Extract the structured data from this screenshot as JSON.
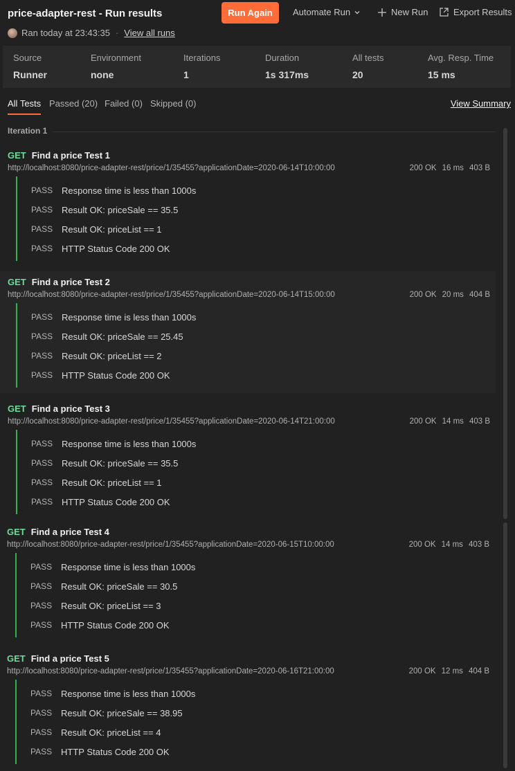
{
  "header": {
    "title": "price-adapter-rest - Run results",
    "run_again": "Run Again",
    "automate_run": "Automate Run",
    "new_run": "New Run",
    "export_results": "Export Results",
    "ran_text": "Ran today at 23:43:35",
    "separator": "·",
    "view_all_runs": "View all runs"
  },
  "stats": [
    {
      "label": "Source",
      "value": "Runner"
    },
    {
      "label": "Environment",
      "value": "none"
    },
    {
      "label": "Iterations",
      "value": "1"
    },
    {
      "label": "Duration",
      "value": "1s 317ms"
    },
    {
      "label": "All tests",
      "value": "20"
    },
    {
      "label": "Avg. Resp. Time",
      "value": "15 ms"
    }
  ],
  "tabs": [
    {
      "label": "All Tests",
      "active": true
    },
    {
      "label": "Passed (20)",
      "active": false
    },
    {
      "label": "Failed (0)",
      "active": false
    },
    {
      "label": "Skipped (0)",
      "active": false
    }
  ],
  "view_summary": "View Summary",
  "iteration_label": "Iteration 1",
  "colors": {
    "accent": "#ff6c37",
    "method": "#6bdd9a",
    "pass_bar": "#2fb34a"
  },
  "requests": [
    {
      "method": "GET",
      "name": "Find a price Test 1",
      "url": "http://localhost:8080/price-adapter-rest/price/1/35455?applicationDate=2020-06-14T10:00:00",
      "status": "200 OK",
      "time": "16 ms",
      "size": "403 B",
      "assertions": [
        {
          "result": "PASS",
          "text": "Response time is less than 1000s"
        },
        {
          "result": "PASS",
          "text": "Result OK: priceSale == 35.5"
        },
        {
          "result": "PASS",
          "text": "Result OK: priceList == 1"
        },
        {
          "result": "PASS",
          "text": "HTTP Status Code 200 OK"
        }
      ]
    },
    {
      "method": "GET",
      "name": "Find a price Test 2",
      "url": "http://localhost:8080/price-adapter-rest/price/1/35455?applicationDate=2020-06-14T15:00:00",
      "status": "200 OK",
      "time": "20 ms",
      "size": "404 B",
      "assertions": [
        {
          "result": "PASS",
          "text": "Response time is less than 1000s"
        },
        {
          "result": "PASS",
          "text": "Result OK: priceSale == 25.45"
        },
        {
          "result": "PASS",
          "text": "Result OK: priceList == 2"
        },
        {
          "result": "PASS",
          "text": "HTTP Status Code 200 OK"
        }
      ]
    },
    {
      "method": "GET",
      "name": "Find a price Test 3",
      "url": "http://localhost:8080/price-adapter-rest/price/1/35455?applicationDate=2020-06-14T21:00:00",
      "status": "200 OK",
      "time": "14 ms",
      "size": "403 B",
      "assertions": [
        {
          "result": "PASS",
          "text": "Response time is less than 1000s"
        },
        {
          "result": "PASS",
          "text": "Result OK: priceSale == 35.5"
        },
        {
          "result": "PASS",
          "text": "Result OK: priceList == 1"
        },
        {
          "result": "PASS",
          "text": "HTTP Status Code 200 OK"
        }
      ]
    },
    {
      "method": "GET",
      "name": "Find a price Test 4",
      "url": "http://localhost:8080/price-adapter-rest/price/1/35455?applicationDate=2020-06-15T10:00:00",
      "status": "200 OK",
      "time": "14 ms",
      "size": "403 B",
      "assertions": [
        {
          "result": "PASS",
          "text": "Response time is less than 1000s"
        },
        {
          "result": "PASS",
          "text": "Result OK: priceSale == 30.5"
        },
        {
          "result": "PASS",
          "text": "Result OK: priceList == 3"
        },
        {
          "result": "PASS",
          "text": "HTTP Status Code 200 OK"
        }
      ]
    },
    {
      "method": "GET",
      "name": "Find a price Test 5",
      "url": "http://localhost:8080/price-adapter-rest/price/1/35455?applicationDate=2020-06-16T21:00:00",
      "status": "200 OK",
      "time": "12 ms",
      "size": "404 B",
      "assertions": [
        {
          "result": "PASS",
          "text": "Response time is less than 1000s"
        },
        {
          "result": "PASS",
          "text": "Result OK: priceSale == 38.95"
        },
        {
          "result": "PASS",
          "text": "Result OK: priceList == 4"
        },
        {
          "result": "PASS",
          "text": "HTTP Status Code 200 OK"
        }
      ]
    }
  ]
}
